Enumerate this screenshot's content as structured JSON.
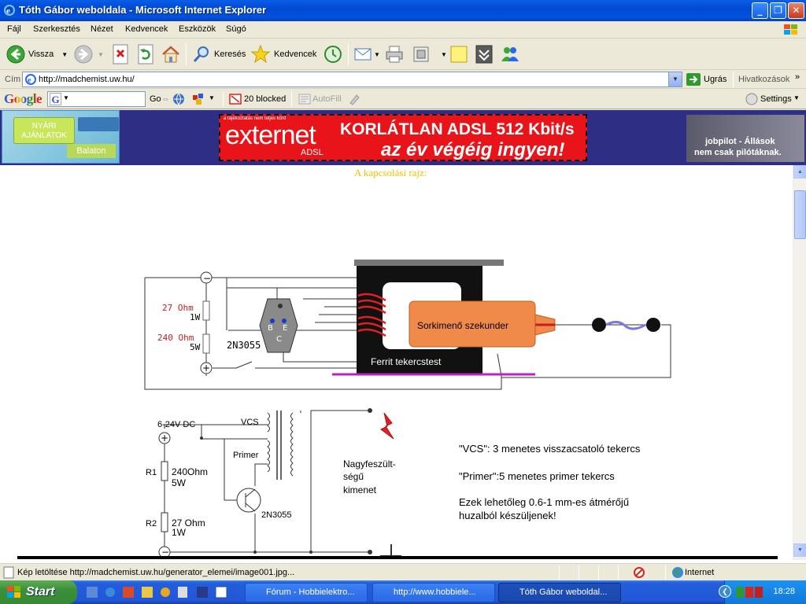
{
  "window": {
    "title": "Tóth Gábor weboldala - Microsoft Internet Explorer"
  },
  "menu": [
    "Fájl",
    "Szerkesztés",
    "Nézet",
    "Kedvencek",
    "Eszközök",
    "Súgó"
  ],
  "toolbar": {
    "back": "Vissza",
    "search": "Keresés",
    "favorites": "Kedvencek"
  },
  "address": {
    "label": "Cím",
    "url": "http://madchemist.uw.hu/",
    "go": "Ugrás",
    "links": "Hivatkozások"
  },
  "google": {
    "logo": "Google",
    "go": "Go",
    "blocked": "20 blocked",
    "autofill": "AutoFill",
    "settings": "Settings"
  },
  "banner": {
    "left_line1": "NYÁRI",
    "left_line2": "AJÁNLATOK",
    "left_sub": "Balaton",
    "ad_small": "a tájékoztatás nem teljes körű",
    "ad_brand": "externet",
    "ad_adsl": "ADSL",
    "ad_line1": "KORLÁTLAN ADSL 512 Kbit/s",
    "ad_line2": "az év végéig ingyen!",
    "right_line1": "jobpilot - Állások",
    "right_line2": "nem csak pilótáknak."
  },
  "page": {
    "heading": "A kapcsolási rajz:",
    "d1": {
      "r1": "27 Ohm",
      "r1w": "1W",
      "r2": "240 Ohm",
      "r2w": "5W",
      "transistor": "2N3055",
      "b": "B",
      "e": "E",
      "c": "C",
      "secondary": "Sorkimenő szekunder",
      "core": "Ferrit tekercstest",
      "minus": "−",
      "plus": "+"
    },
    "d2": {
      "supply": "6-24V DC",
      "vcs": "VCS",
      "primer": "Primer",
      "r1": "R1",
      "r1v": "240Ohm",
      "r1w": "5W",
      "r2": "R2",
      "r2v": "27 Ohm",
      "r2w": "1W",
      "transistor": "2N3055",
      "out1": "Nagyfeszült-",
      "out2": "ségű",
      "out3": "kimenet"
    },
    "notes": [
      "\"VCS\": 3 menetes visszacsatoló tekercs",
      "\"Primer\":5 menetes primer tekercs",
      "Ezek lehetőleg 0.6-1 mm-es átmérőjű",
      "huzalból készüljenek!"
    ]
  },
  "status": {
    "message": "Kép letöltése http://madchemist.uw.hu/generator_elemei/image001.jpg...",
    "zone": "Internet"
  },
  "taskbar": {
    "start": "Start",
    "tasks": [
      "Fórum - Hobbielektro...",
      "http://www.hobbiele...",
      "Tóth Gábor weboldal..."
    ],
    "clock": "18:28"
  }
}
